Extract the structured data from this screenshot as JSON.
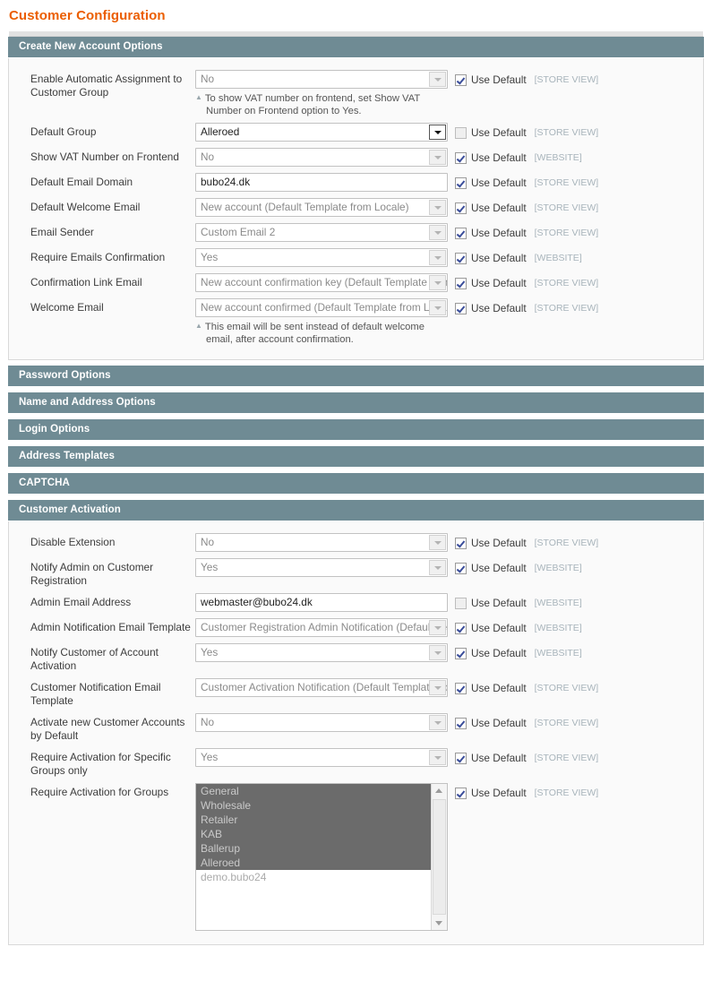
{
  "page": {
    "title": "Customer Configuration"
  },
  "labels": {
    "use_default": "Use Default",
    "scope_store_view": "[STORE VIEW]",
    "scope_website": "[WEBSITE]"
  },
  "sections": [
    {
      "id": "create-new-account-options",
      "title": "Create New Account Options",
      "expanded": true,
      "rows": [
        {
          "label": "Enable Automatic Assignment to Customer Group",
          "control": "select",
          "value": "No",
          "enabled": false,
          "hint_line1": "To show VAT number on frontend, set Show VAT",
          "hint_line2": "Number on Frontend option to Yes.",
          "use_default": true,
          "scope": "[STORE VIEW]"
        },
        {
          "label": "Default Group",
          "control": "select",
          "value": "Alleroed",
          "enabled": true,
          "use_default": false,
          "scope": "[STORE VIEW]"
        },
        {
          "label": "Show VAT Number on Frontend",
          "control": "select",
          "value": "No",
          "enabled": false,
          "use_default": true,
          "scope": "[WEBSITE]"
        },
        {
          "label": "Default Email Domain",
          "control": "text",
          "value": "bubo24.dk",
          "enabled": true,
          "use_default": true,
          "scope": "[STORE VIEW]"
        },
        {
          "label": "Default Welcome Email",
          "control": "select",
          "value": "New account (Default Template from Locale)",
          "enabled": false,
          "use_default": true,
          "scope": "[STORE VIEW]"
        },
        {
          "label": "Email Sender",
          "control": "select",
          "value": "Custom Email 2",
          "enabled": false,
          "use_default": true,
          "scope": "[STORE VIEW]"
        },
        {
          "label": "Require Emails Confirmation",
          "control": "select",
          "value": "Yes",
          "enabled": false,
          "use_default": true,
          "scope": "[WEBSITE]"
        },
        {
          "label": "Confirmation Link Email",
          "control": "select",
          "value": "New account confirmation key (Default Template from Locale)",
          "enabled": false,
          "use_default": true,
          "scope": "[STORE VIEW]"
        },
        {
          "label": "Welcome Email",
          "control": "select",
          "value": "New account confirmed (Default Template from Locale)",
          "enabled": false,
          "hint_line1": "This email will be sent instead of default welcome",
          "hint_line2": "email, after account confirmation.",
          "use_default": true,
          "scope": "[STORE VIEW]"
        }
      ]
    },
    {
      "id": "password-options",
      "title": "Password Options",
      "expanded": false,
      "rows": []
    },
    {
      "id": "name-and-address-options",
      "title": "Name and Address Options",
      "expanded": false,
      "rows": []
    },
    {
      "id": "login-options",
      "title": "Login Options",
      "expanded": false,
      "rows": []
    },
    {
      "id": "address-templates",
      "title": "Address Templates",
      "expanded": false,
      "rows": []
    },
    {
      "id": "captcha",
      "title": "CAPTCHA",
      "expanded": false,
      "rows": []
    },
    {
      "id": "customer-activation",
      "title": "Customer Activation",
      "expanded": true,
      "rows": [
        {
          "label": "Disable Extension",
          "control": "select",
          "value": "No",
          "enabled": false,
          "use_default": true,
          "scope": "[STORE VIEW]"
        },
        {
          "label": "Notify Admin on Customer Registration",
          "control": "select",
          "value": "Yes",
          "enabled": false,
          "use_default": true,
          "scope": "[WEBSITE]"
        },
        {
          "label": "Admin Email Address",
          "control": "text",
          "value": "webmaster@bubo24.dk",
          "enabled": true,
          "use_default": false,
          "scope": "[WEBSITE]"
        },
        {
          "label": "Admin Notification Email Template",
          "control": "select",
          "value": "Customer Registration Admin Notification (Default Template from Locale)",
          "enabled": false,
          "use_default": true,
          "scope": "[WEBSITE]"
        },
        {
          "label": "Notify Customer of Account Activation",
          "control": "select",
          "value": "Yes",
          "enabled": false,
          "use_default": true,
          "scope": "[WEBSITE]"
        },
        {
          "label": "Customer Notification Email Template",
          "control": "select",
          "value": "Customer Activation Notification (Default Template from Locale)",
          "enabled": false,
          "use_default": true,
          "scope": "[STORE VIEW]"
        },
        {
          "label": "Activate new Customer Accounts by Default",
          "control": "select",
          "value": "No",
          "enabled": false,
          "use_default": true,
          "scope": "[STORE VIEW]"
        },
        {
          "label": "Require Activation for Specific Groups only",
          "control": "select",
          "value": "Yes",
          "enabled": false,
          "use_default": true,
          "scope": "[STORE VIEW]"
        },
        {
          "label": "Require Activation for Groups",
          "control": "multiselect",
          "options": [
            {
              "label": "General",
              "selected": true
            },
            {
              "label": "Wholesale",
              "selected": true
            },
            {
              "label": "Retailer",
              "selected": true
            },
            {
              "label": "KAB",
              "selected": true
            },
            {
              "label": "Ballerup",
              "selected": true
            },
            {
              "label": "Alleroed",
              "selected": true
            },
            {
              "label": "demo.bubo24",
              "selected": false
            }
          ],
          "use_default": true,
          "scope": "[STORE VIEW]"
        }
      ]
    }
  ]
}
